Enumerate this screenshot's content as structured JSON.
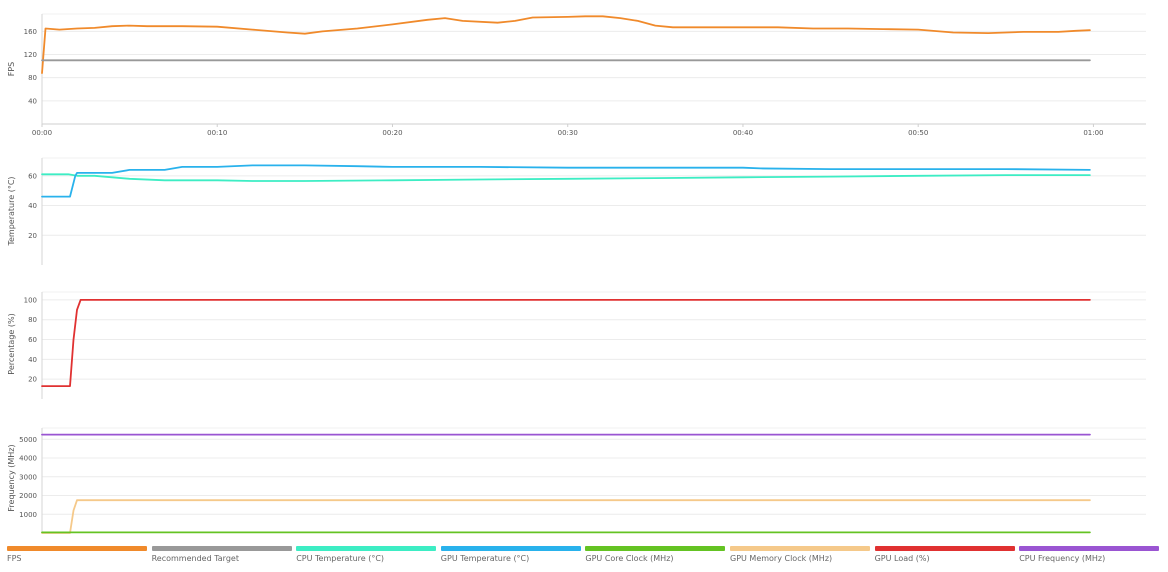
{
  "colors": {
    "fps": "#f08a2b",
    "recommended_target": "#999999",
    "cpu_temperature": "#3dedc4",
    "gpu_temperature": "#29b2ec",
    "gpu_core_clock": "#64c323",
    "gpu_memory_clock": "#f5c98a",
    "gpu_load": "#e03131",
    "cpu_frequency": "#9a55d2"
  },
  "legend": [
    {
      "label": "FPS",
      "color_key": "fps"
    },
    {
      "label": "Recommended Target",
      "color_key": "recommended_target"
    },
    {
      "label": "CPU Temperature (°C)",
      "color_key": "cpu_temperature"
    },
    {
      "label": "GPU Temperature (°C)",
      "color_key": "gpu_temperature"
    },
    {
      "label": "GPU Core Clock (MHz)",
      "color_key": "gpu_core_clock"
    },
    {
      "label": "GPU Memory Clock (MHz)",
      "color_key": "gpu_memory_clock"
    },
    {
      "label": "GPU Load (%)",
      "color_key": "gpu_load"
    },
    {
      "label": "CPU Frequency (MHz)",
      "color_key": "cpu_frequency"
    }
  ],
  "chart_data": [
    {
      "type": "line",
      "ylabel": "FPS",
      "ylim": [
        0,
        190
      ],
      "yticks": [
        40,
        80,
        120,
        160
      ],
      "xlim": [
        0,
        63
      ],
      "xticks": [
        0,
        10,
        20,
        30,
        40,
        50,
        60
      ],
      "xticklabels": [
        "00:00",
        "00:10",
        "00:20",
        "00:30",
        "00:40",
        "00:50",
        "01:00"
      ],
      "grid": true,
      "series": [
        {
          "name": "FPS",
          "color_key": "fps",
          "x": [
            0,
            0.2,
            1,
            2,
            3,
            4,
            5,
            6,
            8,
            10,
            12,
            14,
            15,
            16,
            18,
            20,
            22,
            23,
            24,
            26,
            27,
            28,
            30,
            31,
            32,
            33,
            34,
            35,
            36,
            38,
            40,
            42,
            44,
            46,
            48,
            50,
            52,
            54,
            56,
            58,
            59,
            59.8
          ],
          "y": [
            88,
            165,
            163,
            165,
            166,
            169,
            170,
            169,
            169,
            168,
            163,
            158,
            156,
            160,
            165,
            172,
            180,
            183,
            178,
            175,
            178,
            184,
            185,
            186,
            186,
            183,
            178,
            170,
            167,
            167,
            167,
            167,
            165,
            165,
            164,
            163,
            158,
            157,
            159,
            159,
            161,
            162
          ]
        },
        {
          "name": "Recommended Target",
          "color_key": "recommended_target",
          "x": [
            0,
            59.8
          ],
          "y": [
            110,
            110
          ]
        }
      ]
    },
    {
      "type": "line",
      "ylabel": "Temperature (°C)",
      "ylim": [
        0,
        72
      ],
      "yticks": [
        20,
        40,
        60
      ],
      "xlim": [
        0,
        63
      ],
      "grid": true,
      "series": [
        {
          "name": "CPU Temperature (°C)",
          "color_key": "cpu_temperature",
          "x": [
            0,
            1.5,
            2,
            3,
            4,
            5,
            7,
            10,
            12,
            15,
            20,
            25,
            30,
            35,
            40,
            45,
            50,
            55,
            59.8
          ],
          "y": [
            61,
            61,
            60,
            60,
            59,
            58,
            57,
            57,
            56.5,
            56.5,
            57,
            57.5,
            58,
            58.5,
            59,
            59.5,
            60,
            60.5,
            60.5
          ]
        },
        {
          "name": "GPU Temperature (°C)",
          "color_key": "gpu_temperature",
          "x": [
            0,
            1.6,
            1.9,
            2,
            3,
            4,
            5,
            6,
            7,
            8,
            10,
            12,
            15,
            18,
            20,
            25,
            30,
            35,
            40,
            41,
            45,
            50,
            55,
            59.8
          ],
          "y": [
            46,
            46,
            60,
            62,
            62,
            62,
            64,
            64,
            64,
            66,
            66,
            67,
            67,
            66.5,
            66,
            66,
            65.5,
            65.5,
            65.5,
            65,
            64.5,
            64.5,
            64.5,
            64
          ]
        }
      ]
    },
    {
      "type": "line",
      "ylabel": "Percentage (%)",
      "ylim": [
        0,
        108
      ],
      "yticks": [
        20,
        40,
        60,
        80,
        100
      ],
      "xlim": [
        0,
        63
      ],
      "grid": true,
      "series": [
        {
          "name": "GPU Load (%)",
          "color_key": "gpu_load",
          "x": [
            0,
            1.6,
            1.8,
            2.0,
            2.2,
            59.8
          ],
          "y": [
            13,
            13,
            60,
            90,
            100,
            100
          ]
        }
      ]
    },
    {
      "type": "line",
      "ylabel": "Frequency (MHz)",
      "ylim": [
        0,
        5600
      ],
      "yticks": [
        1000,
        2000,
        3000,
        4000,
        5000
      ],
      "xlim": [
        0,
        63
      ],
      "grid": true,
      "series": [
        {
          "name": "CPU Frequency (MHz)",
          "color_key": "cpu_frequency",
          "x": [
            0,
            59.8
          ],
          "y": [
            5250,
            5250
          ]
        },
        {
          "name": "GPU Memory Clock (MHz)",
          "color_key": "gpu_memory_clock",
          "x": [
            0,
            1.6,
            1.8,
            2.0,
            59.8
          ],
          "y": [
            0,
            0,
            1200,
            1750,
            1750
          ]
        },
        {
          "name": "GPU Core Clock (MHz)",
          "color_key": "gpu_core_clock",
          "x": [
            0,
            59.8
          ],
          "y": [
            30,
            30
          ]
        }
      ]
    }
  ]
}
